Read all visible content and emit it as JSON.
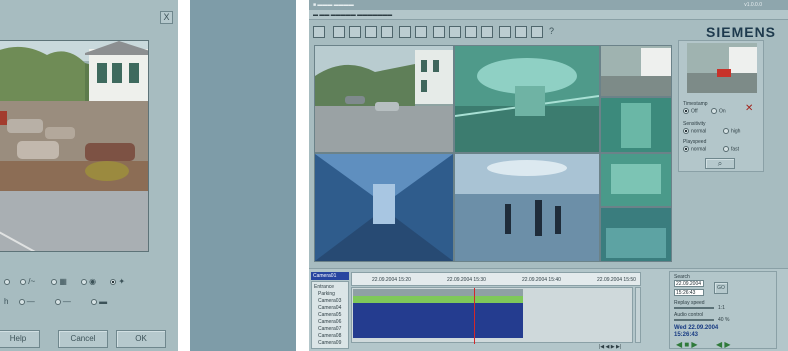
{
  "dialog": {
    "close_label": "X",
    "options_row1": [
      "",
      "",
      "",
      ""
    ],
    "options_row2": [
      "",
      "",
      ""
    ],
    "buttons": {
      "help": "Help",
      "cancel": "Cancel",
      "ok": "OK"
    }
  },
  "app": {
    "version": "v1.0.0.0",
    "brand": "SIEMENS",
    "brand_color": "#1e3a4d",
    "side_panel": {
      "timestamp_label": "Timestamp",
      "timestamp_opts": [
        "Off",
        "On"
      ],
      "sensitivity_label": "Sensitivity",
      "sensitivity_opts": [
        "normal",
        "high"
      ],
      "playspeed_label": "Playspeed",
      "playspeed_opts": [
        "normal",
        "fast"
      ]
    },
    "timeline": {
      "camera_select": "Camera01",
      "tree": [
        "Entrance",
        "Parking",
        "Camera03",
        "Camera04",
        "Camera05",
        "Camera06",
        "Camera07",
        "Camera08",
        "Camera09"
      ],
      "ticks": [
        "22.09.2004 15:20",
        "22.09.2004 15:30",
        "22.09.2004 15:40",
        "22.09.2004 15:50"
      ],
      "zoom_label": "Zoom"
    },
    "controls": {
      "search_label": "Search",
      "date_value": "22.09.2004",
      "time_value": "15:26:43",
      "go_label": "GO",
      "replay_label": "Replay speed",
      "replay_value": "1:1",
      "audio_label": "Audio control",
      "audio_value": "40 %",
      "date_time_line1": "Wed 22.09.2004",
      "date_time_line2": "15:26:43"
    }
  }
}
